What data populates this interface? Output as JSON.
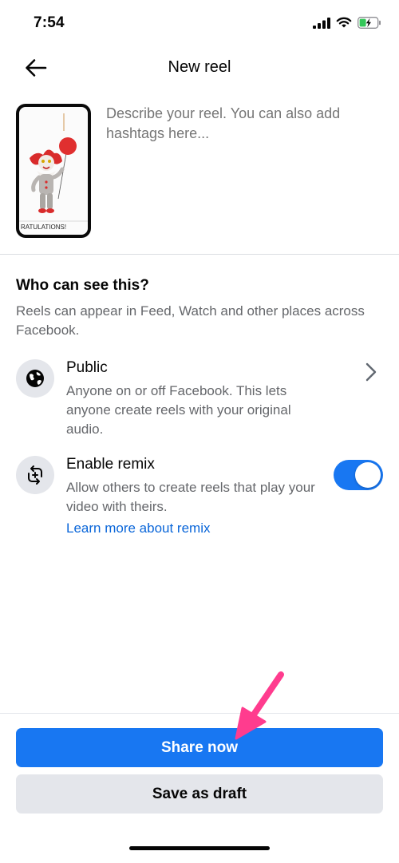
{
  "status_bar": {
    "time": "7:54"
  },
  "header": {
    "title": "New reel"
  },
  "composer": {
    "placeholder": "Describe your reel. You can also add hashtags here...",
    "thumbnail_caption": "RATULATIONS!"
  },
  "audience": {
    "title": "Who can see this?",
    "description": "Reels can appear in Feed, Watch and other places across Facebook."
  },
  "options": {
    "public": {
      "title": "Public",
      "description": "Anyone on or off Facebook. This lets anyone create reels with your original audio."
    },
    "remix": {
      "title": "Enable remix",
      "description": "Allow others to create reels that play your video with theirs.",
      "link": "Learn more about remix",
      "enabled": true
    }
  },
  "actions": {
    "share_label": "Share now",
    "draft_label": "Save as draft"
  },
  "colors": {
    "accent": "#1877f2",
    "link": "#0a66d9",
    "annotation_arrow": "#ff3c8e"
  },
  "icons": [
    "signal-icon",
    "wifi-icon",
    "battery-charging-icon",
    "back-arrow-icon",
    "globe-icon",
    "remix-icon",
    "chevron-right-icon"
  ]
}
